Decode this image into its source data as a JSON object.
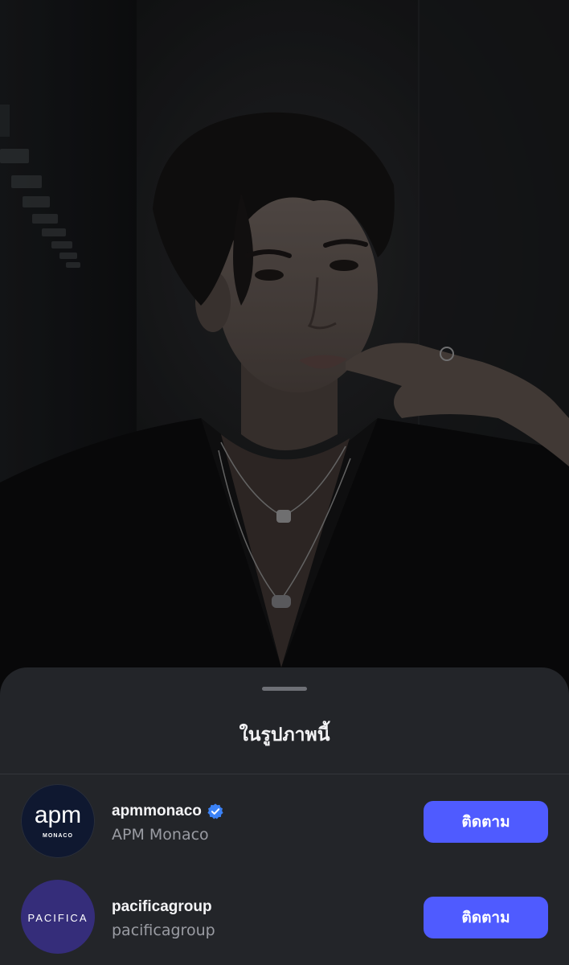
{
  "photo": {
    "subject": "photo-of-person-dark-background"
  },
  "sheet": {
    "title": "ในรูปภาพนี้",
    "accounts": [
      {
        "username": "apmmonaco",
        "full_name": "APM Monaco",
        "verified": true,
        "avatar_logo_main": "apm",
        "avatar_logo_sub": "MONACO",
        "follow_label": "ติดตาม"
      },
      {
        "username": "pacificagroup",
        "full_name": "pacificagroup",
        "verified": false,
        "avatar_logo_main": "PACIFICA",
        "follow_label": "ติดตาม"
      }
    ]
  },
  "colors": {
    "sheet_background": "#232529",
    "follow_button": "#4f5bff",
    "verified_badge": "#3b82f6",
    "primary_text": "#f4f4f6",
    "secondary_text": "#9a9ca3"
  }
}
